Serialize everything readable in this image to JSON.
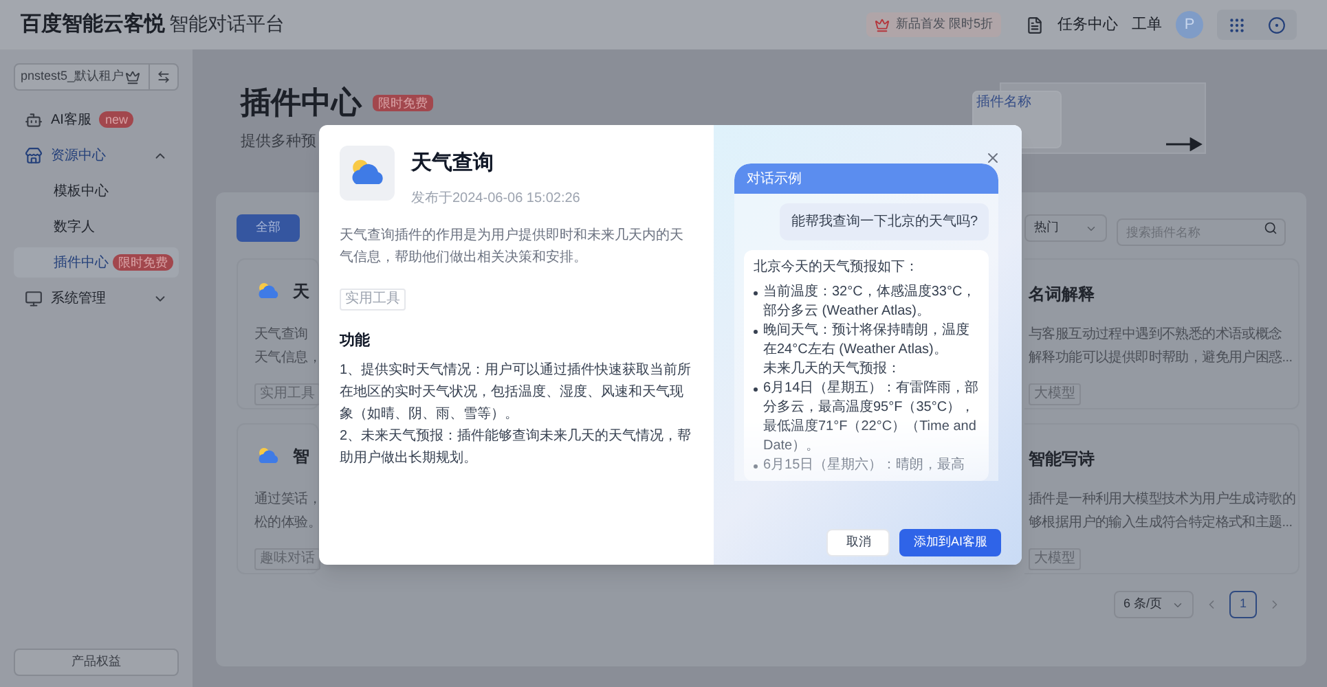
{
  "header": {
    "logo": "百度智能云客悦",
    "product": "智能对话平台",
    "promo": "新品首发 限时5折",
    "links": [
      "任务中心",
      "工单"
    ],
    "avatar": "P"
  },
  "sidebar": {
    "tenant": "pnstest5_默认租户",
    "items": [
      {
        "kind": "item",
        "label": "AI客服",
        "badge": "new",
        "selected": false
      },
      {
        "kind": "group",
        "label": "资源中心",
        "expanded": true,
        "selected": true,
        "children": [
          {
            "label": "模板中心",
            "selected": false
          },
          {
            "label": "数字人",
            "selected": false
          },
          {
            "label": "插件中心",
            "selected": true,
            "badge": "限时免费"
          }
        ]
      },
      {
        "kind": "group",
        "label": "系统管理",
        "expanded": false,
        "selected": false
      }
    ],
    "footer_button": "产品权益"
  },
  "page": {
    "title": "插件中心",
    "badge": "限时免费",
    "subtitle": "提供多种预",
    "illustration_label": "插件名称"
  },
  "filters": {
    "tabs": [
      {
        "label": "全部",
        "selected": true
      }
    ],
    "sort": "热门",
    "search": {
      "placeholder": "搜索插件名称"
    }
  },
  "cards_left": [
    {
      "title": "天",
      "description": [
        "天气查询",
        "天气信息，"
      ],
      "tag": "实用工具"
    },
    {
      "title": "智",
      "description": [
        "通过笑话，",
        "松的体验。"
      ],
      "tag": "趣味对话"
    }
  ],
  "cards_right": [
    {
      "title": "名词解释",
      "description": [
        "与客服互动过程中遇到不熟悉的术语或概念",
        "解释功能可以提供即时帮助，避免用户困惑..."
      ],
      "tag": "大模型"
    },
    {
      "title": "智能写诗",
      "description": [
        "插件是一种利用大模型技术为用户生成诗歌的",
        "够根据用户的输入生成符合特定格式和主题..."
      ],
      "tag": "大模型"
    }
  ],
  "pagination": {
    "page_size": "6 条/页",
    "pages": [
      {
        "label": "1",
        "selected": true
      }
    ]
  },
  "modal": {
    "title": "天气查询",
    "published": "发布于2024-06-06 15:02:26",
    "description": "天气查询插件的作用是为用户提供即时和未来几天内的天气信息，帮助他们做出相关决策和安排。",
    "tag": "实用工具",
    "section_title": "功能",
    "features": [
      "1、提供实时天气情况：用户可以通过插件快速获取当前所在地区的实时天气状况，包括温度、湿度、风速和天气现象（如晴、阴、雨、雪等）。",
      "2、未来天气预报：插件能够查询未来几天的天气情况，帮助用户做出长期规划。"
    ],
    "chat": {
      "title": "对话示例",
      "question": "能帮我查询一下北京的天气吗?",
      "answer": [
        {
          "kind": "text",
          "text": "北京今天的天气预报如下："
        },
        {
          "kind": "bullet",
          "text": "当前温度：32°C，体感温度33°C，部分多云 (Weather Atlas)。"
        },
        {
          "kind": "bullet",
          "text": "晚间天气：预计将保持晴朗，温度在24°C左右 (Weather Atlas)。"
        },
        {
          "kind": "text",
          "text": "未来几天的天气预报："
        },
        {
          "kind": "bullet",
          "text": "6月14日（星期五）：有雷阵雨，部分多云，最高温度95°F（35°C），最低温度71°F（22°C）（Time and Date）。"
        },
        {
          "kind": "bullet",
          "text": "6月15日（星期六）：晴朗，最高"
        }
      ]
    },
    "buttons": [
      {
        "label": "取消",
        "kind": "secondary"
      },
      {
        "label": "添加到AI客服",
        "kind": "primary"
      }
    ]
  }
}
